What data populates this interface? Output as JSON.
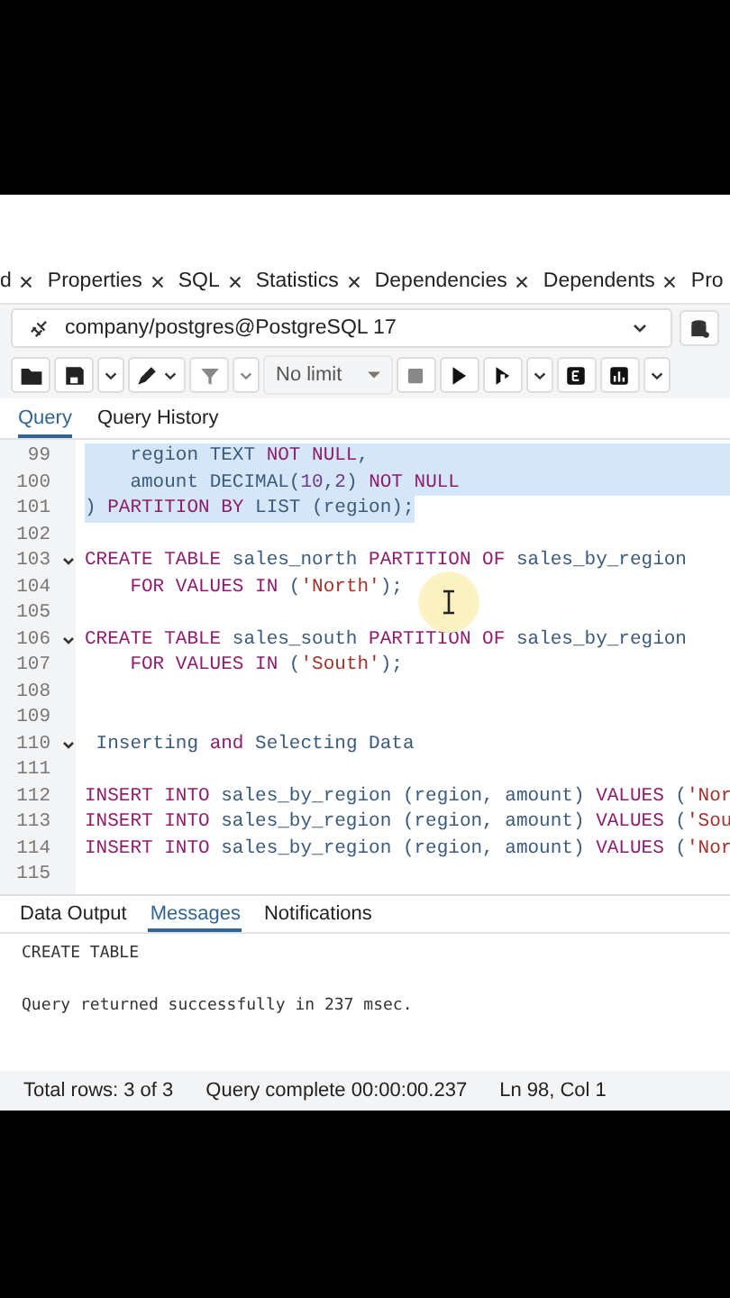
{
  "object_tabs": [
    {
      "label": "d",
      "closable": true
    },
    {
      "label": "Properties",
      "closable": true
    },
    {
      "label": "SQL",
      "closable": true
    },
    {
      "label": "Statistics",
      "closable": true
    },
    {
      "label": "Dependencies",
      "closable": true
    },
    {
      "label": "Dependents",
      "closable": true
    },
    {
      "label": "Pro",
      "closable": false
    }
  ],
  "connection": {
    "value": "company/postgres@PostgreSQL 17"
  },
  "toolbar": {
    "limit": "No limit"
  },
  "query_tabs": [
    {
      "label": "Query",
      "selected": true
    },
    {
      "label": "Query History",
      "selected": false
    }
  ],
  "editor": {
    "lines": [
      {
        "num": "99",
        "fold": false,
        "selected": true,
        "tokens": [
          {
            "t": "    region ",
            "kind": "id"
          },
          {
            "t": "TEXT ",
            "kind": "id"
          },
          {
            "t": "NOT NULL",
            "kind": "kw"
          },
          {
            "t": ",",
            "kind": "id"
          }
        ]
      },
      {
        "num": "100",
        "fold": false,
        "selected": true,
        "tokens": [
          {
            "t": "    amount ",
            "kind": "id"
          },
          {
            "t": "DECIMAL(",
            "kind": "id"
          },
          {
            "t": "10",
            "kind": "num"
          },
          {
            "t": ",",
            "kind": "id"
          },
          {
            "t": "2",
            "kind": "num"
          },
          {
            "t": ") ",
            "kind": "id"
          },
          {
            "t": "NOT NULL",
            "kind": "kw"
          }
        ]
      },
      {
        "num": "101",
        "fold": false,
        "selected": true,
        "tokens": [
          {
            "t": ") ",
            "kind": "id"
          },
          {
            "t": "PARTITION BY ",
            "kind": "kw"
          },
          {
            "t": "LIST (region);",
            "kind": "id"
          }
        ]
      },
      {
        "num": "102",
        "fold": false
      },
      {
        "num": "103",
        "fold": true,
        "selected": false,
        "tokens": [
          {
            "t": "CREATE TABLE ",
            "kind": "kw"
          },
          {
            "t": "sales_north ",
            "kind": "id"
          },
          {
            "t": "PARTITION OF ",
            "kind": "kw"
          },
          {
            "t": "sales_by_region",
            "kind": "id"
          }
        ]
      },
      {
        "num": "104",
        "fold": false,
        "selected": false,
        "tokens": [
          {
            "t": "    FOR VALUES IN ",
            "kind": "kw"
          },
          {
            "t": "(",
            "kind": "id"
          },
          {
            "t": "'North'",
            "kind": "str"
          },
          {
            "t": ");",
            "kind": "id"
          }
        ]
      },
      {
        "num": "105",
        "fold": false
      },
      {
        "num": "106",
        "fold": true,
        "selected": false,
        "tokens": [
          {
            "t": "CREATE TABLE ",
            "kind": "kw"
          },
          {
            "t": "sales_south ",
            "kind": "id"
          },
          {
            "t": "PARTITION OF ",
            "kind": "kw"
          },
          {
            "t": "sales_by_region",
            "kind": "id"
          }
        ]
      },
      {
        "num": "107",
        "fold": false,
        "selected": false,
        "tokens": [
          {
            "t": "    FOR VALUES IN ",
            "kind": "kw"
          },
          {
            "t": "(",
            "kind": "id"
          },
          {
            "t": "'South'",
            "kind": "str"
          },
          {
            "t": ");",
            "kind": "id"
          }
        ]
      },
      {
        "num": "108",
        "fold": false
      },
      {
        "num": "109",
        "fold": false
      },
      {
        "num": "110",
        "fold": true,
        "selected": false,
        "tokens": [
          {
            "t": " Inserting ",
            "kind": "id"
          },
          {
            "t": "and ",
            "kind": "kw"
          },
          {
            "t": "Selecting Data",
            "kind": "id"
          }
        ]
      },
      {
        "num": "111",
        "fold": false
      },
      {
        "num": "112",
        "fold": false,
        "selected": false,
        "tokens": [
          {
            "t": "INSERT INTO ",
            "kind": "kw"
          },
          {
            "t": "sales_by_region (region, amount) ",
            "kind": "id"
          },
          {
            "t": "VALUES ",
            "kind": "kw"
          },
          {
            "t": "(",
            "kind": "id"
          },
          {
            "t": "'Nor",
            "kind": "str"
          }
        ]
      },
      {
        "num": "113",
        "fold": false,
        "selected": false,
        "tokens": [
          {
            "t": "INSERT INTO ",
            "kind": "kw"
          },
          {
            "t": "sales_by_region (region, amount) ",
            "kind": "id"
          },
          {
            "t": "VALUES ",
            "kind": "kw"
          },
          {
            "t": "(",
            "kind": "id"
          },
          {
            "t": "'Sou",
            "kind": "str"
          }
        ]
      },
      {
        "num": "114",
        "fold": false,
        "selected": false,
        "tokens": [
          {
            "t": "INSERT INTO ",
            "kind": "kw"
          },
          {
            "t": "sales_by_region (region, amount) ",
            "kind": "id"
          },
          {
            "t": "VALUES ",
            "kind": "kw"
          },
          {
            "t": "(",
            "kind": "id"
          },
          {
            "t": "'Nor",
            "kind": "str"
          }
        ]
      },
      {
        "num": "115",
        "fold": false
      }
    ]
  },
  "output_tabs": [
    {
      "label": "Data Output",
      "selected": false
    },
    {
      "label": "Messages",
      "selected": true
    },
    {
      "label": "Notifications",
      "selected": false
    }
  ],
  "messages": [
    "CREATE TABLE",
    "Query returned successfully in 237 msec."
  ],
  "status_bar": [
    "Total rows: 3 of 3",
    "Query complete 00:00:00.237",
    "Ln 98, Col 1"
  ]
}
